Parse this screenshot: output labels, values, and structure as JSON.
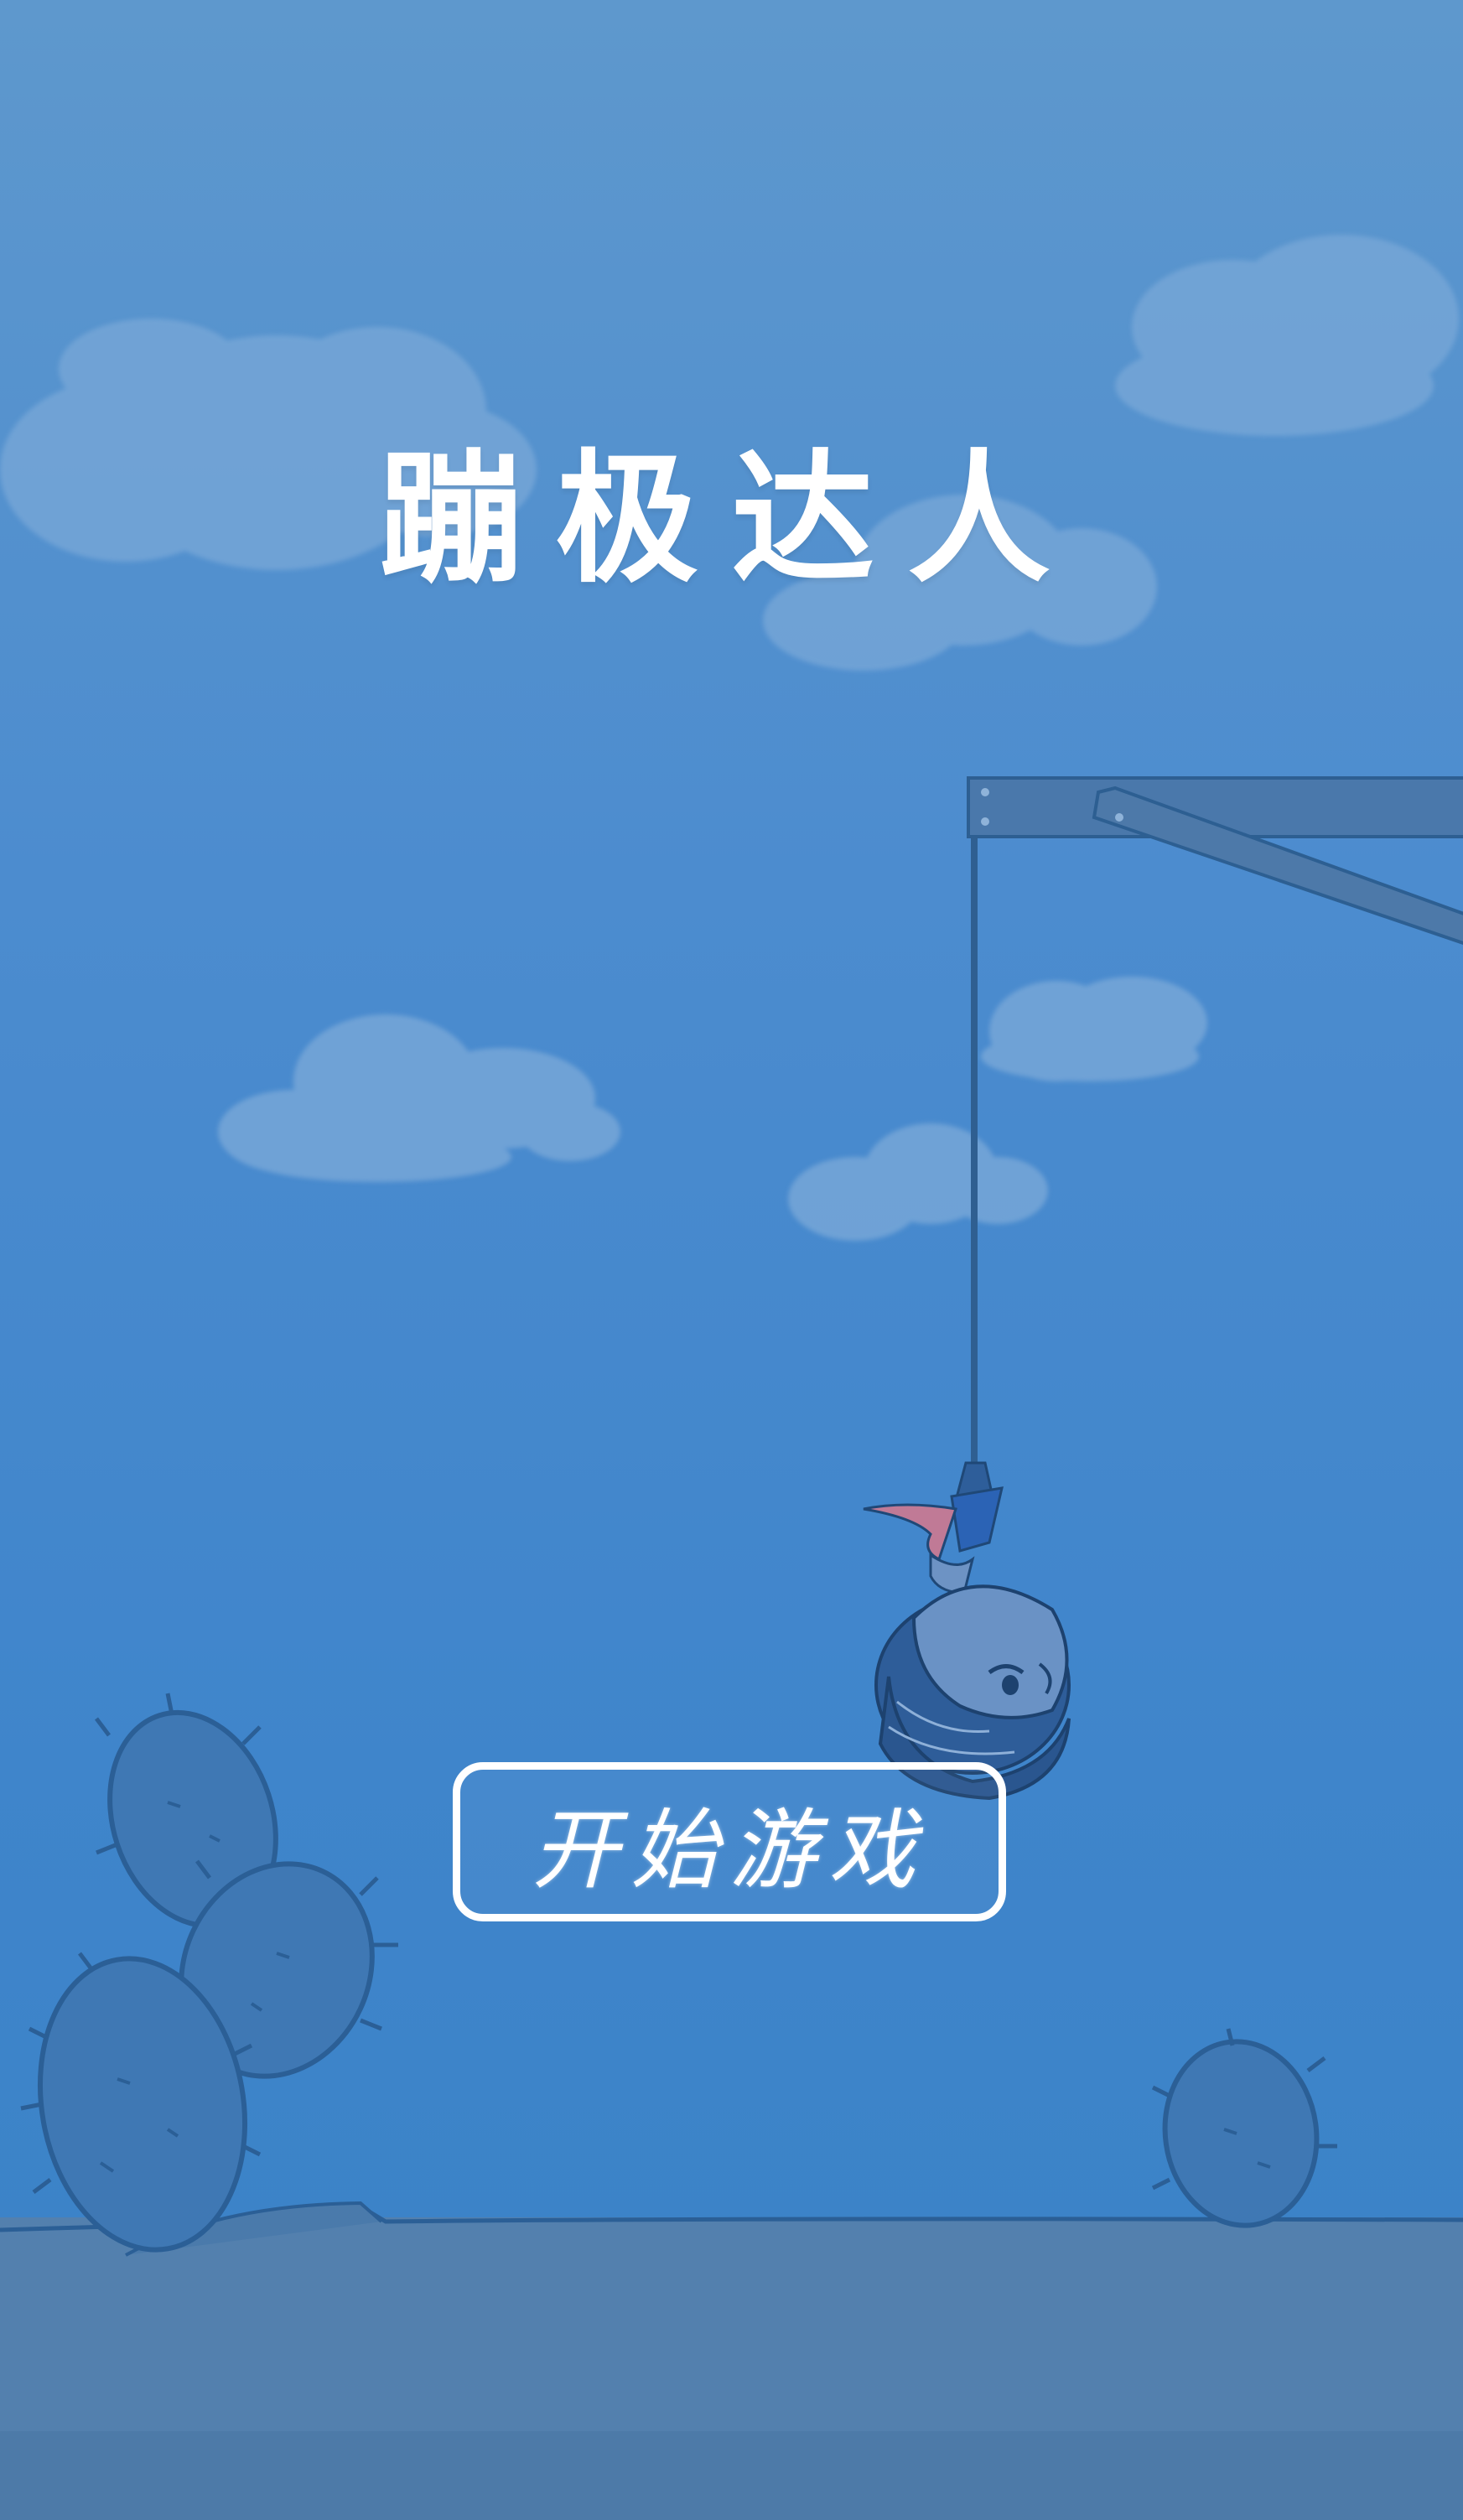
{
  "game": {
    "title": "蹦极达人",
    "start_button_label": "开始游戏"
  },
  "colors": {
    "sky_top": "#5e98cd",
    "sky_bottom": "#3a82c6",
    "ground": "#5380ae",
    "cloud": "#7aa9d9",
    "cactus": "#3f78b4",
    "outline": "#2b5f96",
    "platform": "#4a78ab",
    "text": "#ffffff"
  },
  "scene_objects": {
    "clouds": 5,
    "cacti": 4,
    "characters": 1
  }
}
